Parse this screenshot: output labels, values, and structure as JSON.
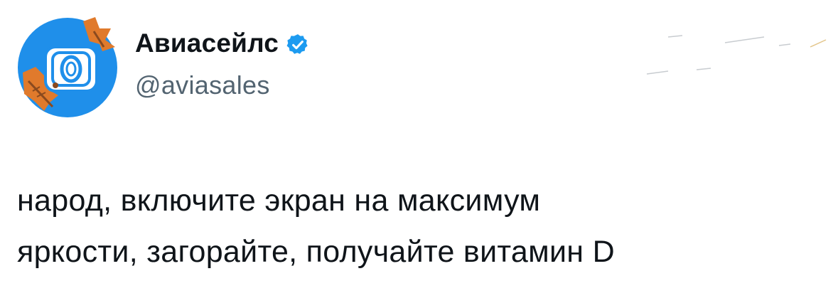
{
  "tweet": {
    "author": {
      "display_name": "Авиасейлс",
      "handle": "@aviasales",
      "verified": true,
      "avatar_icon": "aviasales-logo-icon",
      "verified_icon": "verified-badge-icon"
    },
    "text_lines": [
      "народ, включите экран на максимум",
      "яркости, загорайте, получайте витамин D"
    ]
  },
  "colors": {
    "brand_blue": "#1f8fea",
    "verified_blue": "#1d9bf0",
    "text_primary": "#0f1419",
    "text_secondary": "#536471",
    "leaf_orange": "#e07a2c",
    "leaf_brown": "#8a4a1f"
  }
}
